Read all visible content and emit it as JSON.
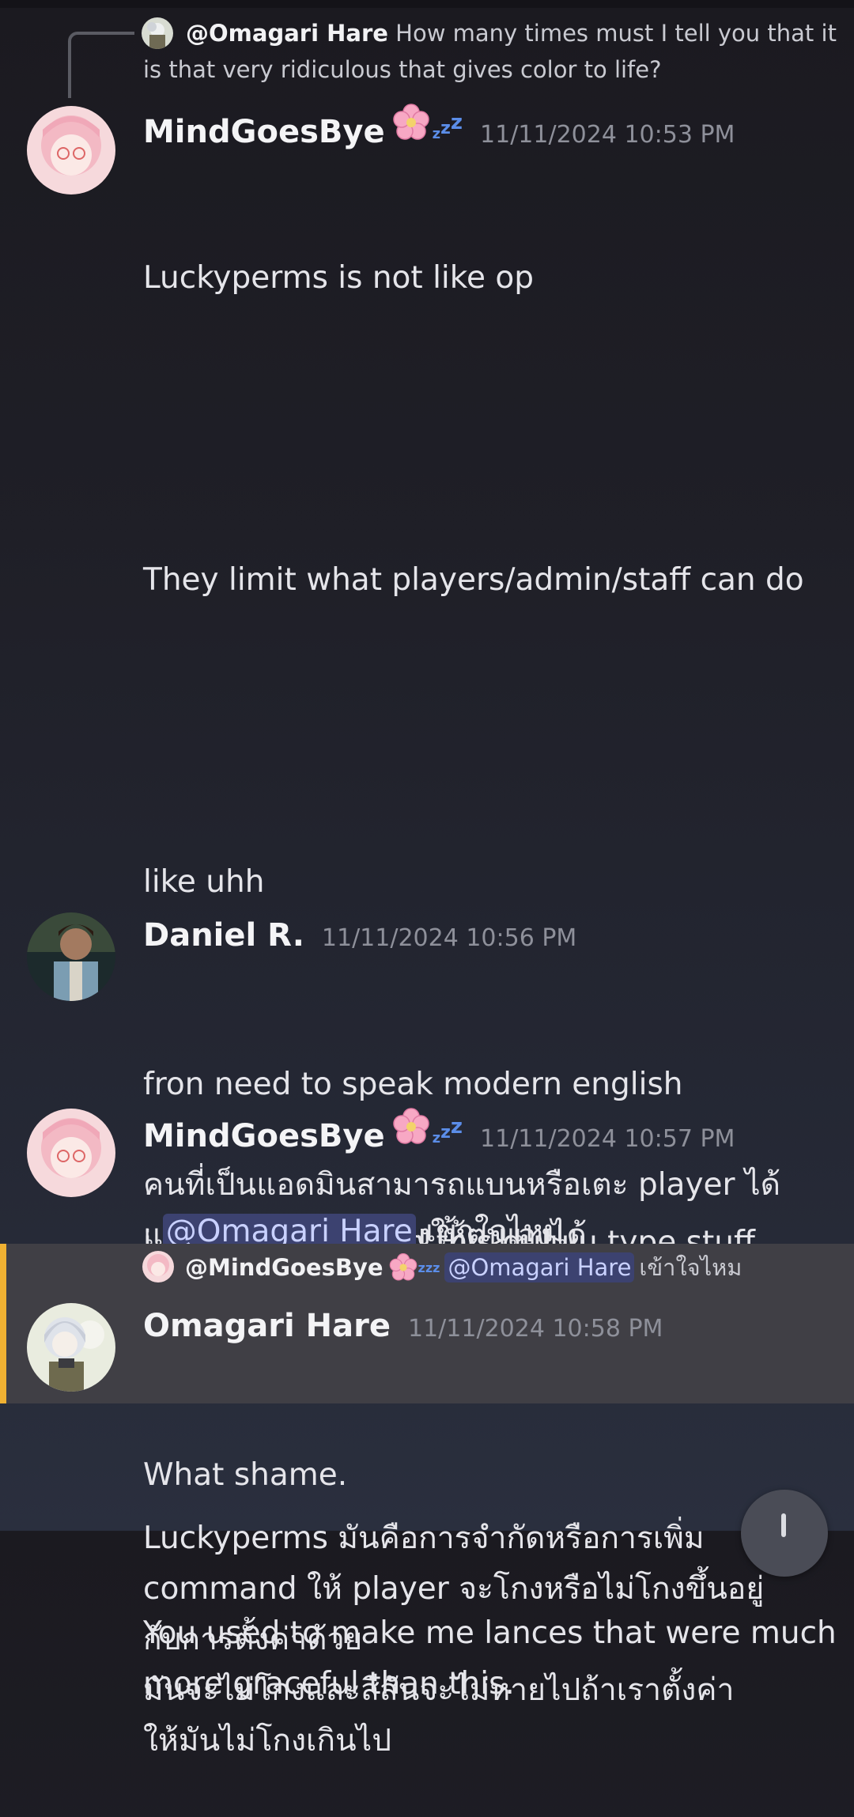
{
  "replies": {
    "top": {
      "author": "@Omagari Hare",
      "text_line1": "How many times must I tell you that it",
      "text_line2": "is that very ridiculous that gives color to life?"
    },
    "bottom": {
      "author": "@MindGoesBye",
      "mention": "@Omagari Hare",
      "text": "เข้าใจไหม"
    }
  },
  "messages": [
    {
      "author": "MindGoesBye",
      "timestamp": "11/11/2024 10:53 PM",
      "lines": [
        "Luckyperms is not like op",
        "",
        "They limit what players/admin/staff can do",
        "",
        "like uhh",
        "",
        "คนที่เป็นแอดมินสามารถแบนหรือเตะ player ได้\nแต่ไม่สามารถเสกของให้ตนเองได้",
        "",
        "Luckyperms มันคือการจำกัดหรือการเพิ่ม\ncommand ให้ player จะโกงหรือไม่โกงขึ้นอยู่\nกับการตั้งค่าด้วย\nมันจะไม่โกงและสีสันจะไม่หายไปถ้าเราตั้งค่า\nให้มันไม่โกงเกินไป"
      ]
    },
    {
      "author": "Daniel R.",
      "timestamp": "11/11/2024 10:56 PM",
      "lines": [
        "fron need to speak modern english",
        "i don't understand this dululu type stuff"
      ]
    },
    {
      "author": "MindGoesBye",
      "timestamp": "11/11/2024 10:57 PM",
      "mention": "@Omagari Hare",
      "text": " เข้าใจไหม"
    },
    {
      "author": "Omagari Hare",
      "timestamp": "11/11/2024 10:58 PM",
      "lines": [
        "What shame.",
        "You used to make me lances that were much\nmore graceful than this."
      ]
    }
  ],
  "icons": {
    "flower": "cherry-blossom-icon",
    "sleep": "zzz-icon",
    "scroll": "arrow-down-icon"
  },
  "colors": {
    "mention_bg": "#3c4270",
    "highlight_bar": "#f0b132",
    "zzz": "#5b8de8"
  }
}
